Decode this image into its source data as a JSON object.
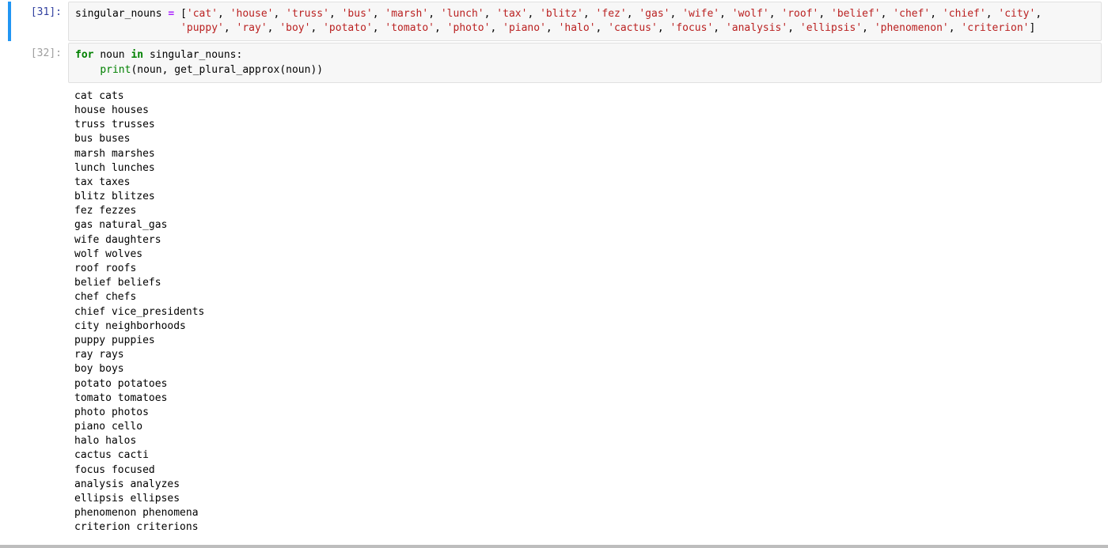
{
  "cells": [
    {
      "prompt": "[31]:",
      "code": {
        "var": "singular_nouns",
        "eq": " = ",
        "lb": "[",
        "rb": "]",
        "comma": ", ",
        "indent": "                 ",
        "strings": [
          "'cat'",
          "'house'",
          "'truss'",
          "'bus'",
          "'marsh'",
          "'lunch'",
          "'tax'",
          "'blitz'",
          "'fez'",
          "'gas'",
          "'wife'",
          "'wolf'",
          "'roof'",
          "'belief'",
          "'chef'",
          "'chief'",
          "'city'",
          "'puppy'",
          "'ray'",
          "'boy'",
          "'potato'",
          "'tomato'",
          "'photo'",
          "'piano'",
          "'halo'",
          "'cactus'",
          "'focus'",
          "'analysis'",
          "'ellipsis'",
          "'phenomenon'",
          "'criterion'"
        ]
      }
    },
    {
      "prompt": "[32]:",
      "code2": {
        "kw_for": "for",
        "sp": " ",
        "var_noun": "noun",
        "kw_in": "in",
        "var_list": "singular_nouns",
        "colon": ":",
        "indent": "    ",
        "fn_print": "print",
        "lp": "(",
        "rp": ")",
        "comma": ", ",
        "fn_gpa": "get_plural_approx",
        "arg": "noun"
      },
      "output": "cat cats\nhouse houses\ntruss trusses\nbus buses\nmarsh marshes\nlunch lunches\ntax taxes\nblitz blitzes\nfez fezzes\ngas natural_gas\nwife daughters\nwolf wolves\nroof roofs\nbelief beliefs\nchef chefs\nchief vice_presidents\ncity neighborhoods\npuppy puppies\nray rays\nboy boys\npotato potatoes\ntomato tomatoes\nphoto photos\npiano cello\nhalo halos\ncactus cacti\nfocus focused\nanalysis analyzes\nellipsis ellipses\nphenomenon phenomena\ncriterion criterions"
    }
  ]
}
